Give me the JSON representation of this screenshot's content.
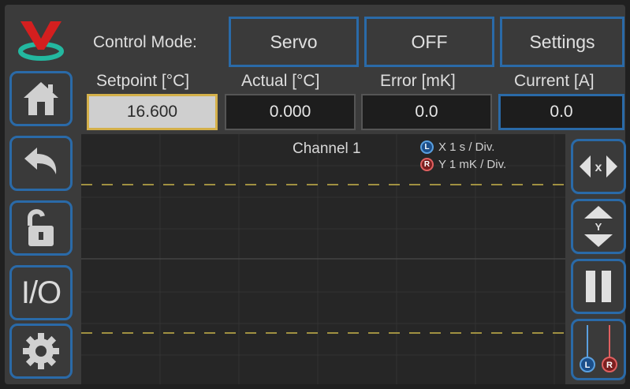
{
  "header": {
    "control_mode_label": "Control Mode:",
    "mode_button": "Servo",
    "output_button": "OFF",
    "settings_button": "Settings"
  },
  "readouts": {
    "setpoint_label": "Setpoint [°C]",
    "actual_label": "Actual [°C]",
    "error_label": "Error [mK]",
    "current_label": "Current [A]",
    "setpoint_value": "16.600",
    "actual_value": "0.000",
    "error_value": "0.0",
    "current_value": "0.0"
  },
  "chart": {
    "title": "Channel 1",
    "x_badge": "L",
    "y_badge": "R",
    "x_scale": "X  1 s / Div.",
    "y_scale": "Y  1 mK / Div."
  },
  "sidebar": {
    "io_label": "I/O"
  },
  "right_controls": {
    "x_zoom_letter": "x",
    "y_zoom_letter": "Y",
    "l_badge": "L",
    "r_badge": "R"
  },
  "colors": {
    "accent_border": "#2a6aa8",
    "setpoint_border": "#d4b04a",
    "limit_line": "#c8b44a",
    "logo_red": "#d41f1f",
    "logo_teal": "#23b8a0"
  },
  "icons": [
    "logo-icon",
    "home-icon",
    "back-icon",
    "unlock-icon",
    "settings-gear-icon",
    "zoom-x-icon",
    "zoom-y-icon",
    "pause-icon",
    "channel-probe-icon"
  ]
}
